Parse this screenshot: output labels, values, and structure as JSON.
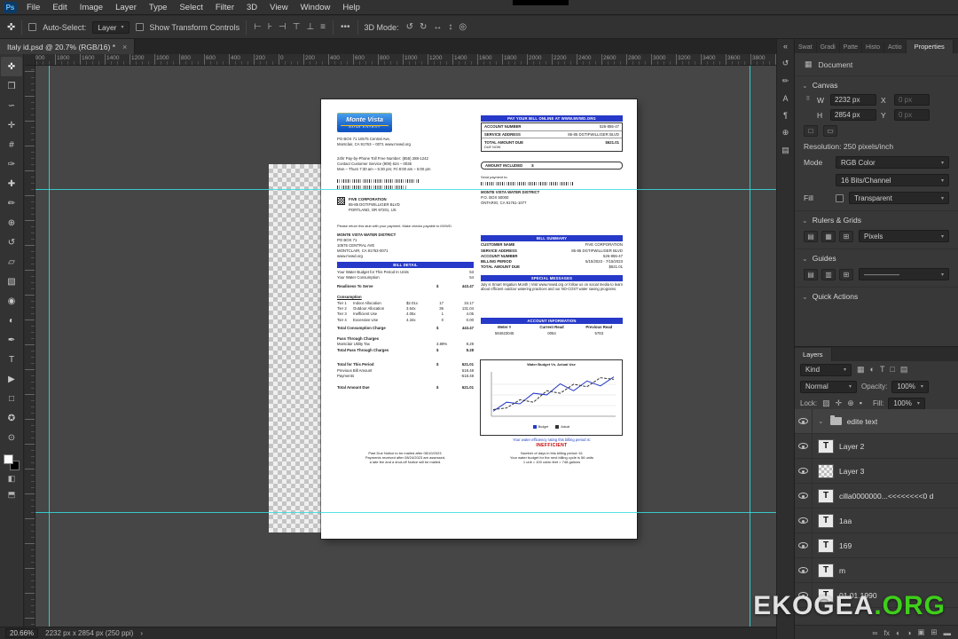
{
  "icons": {
    "ps_logo": "Ps",
    "close": "×",
    "caret_down": "▾",
    "chevron_down": "⌄",
    "chevron_right": "›",
    "ellipsis": "•••",
    "chain_link": "∞",
    "collapse_double": "«",
    "move_tool_glyph": "✜",
    "document_icon": "▦"
  },
  "menu": {
    "items": [
      "File",
      "Edit",
      "Image",
      "Layer",
      "Type",
      "Select",
      "Filter",
      "3D",
      "View",
      "Window",
      "Help"
    ]
  },
  "options": {
    "auto_select_label": "Auto-Select:",
    "auto_select_value": "Layer",
    "transform_label": "Show Transform Controls",
    "mode3d_label": "3D Mode:",
    "align_icons": [
      [
        "align-left",
        "⊢"
      ],
      [
        "align-center-h",
        "⊦"
      ],
      [
        "align-right",
        "⊣"
      ],
      [
        "align-top",
        "⊤"
      ],
      [
        "align-center-v",
        "⊥"
      ],
      [
        "align-bottom",
        "≡"
      ]
    ],
    "mode3d_icons": [
      [
        "3d-rotate",
        "↺"
      ],
      [
        "3d-roll",
        "↻"
      ],
      [
        "3d-pan",
        "↔"
      ],
      [
        "3d-slide",
        "↕"
      ],
      [
        "3d-scale",
        "◎"
      ]
    ]
  },
  "doc_tab": {
    "title": "Italy id.psd @ 20.7% (RGB/16) *"
  },
  "toolbar": {
    "tools": [
      [
        "move-tool",
        "✜"
      ],
      [
        "marquee-tool",
        "❒"
      ],
      [
        "lasso-tool",
        "∽"
      ],
      [
        "quick-selection-tool",
        "✛"
      ],
      [
        "crop-tool",
        "#"
      ],
      [
        "eyedropper-tool",
        "✑"
      ],
      [
        "healing-brush-tool",
        "✚"
      ],
      [
        "brush-tool",
        "✏"
      ],
      [
        "clone-stamp-tool",
        "⊕"
      ],
      [
        "history-brush-tool",
        "↺"
      ],
      [
        "eraser-tool",
        "▱"
      ],
      [
        "gradient-tool",
        "▧"
      ],
      [
        "blur-tool",
        "◉"
      ],
      [
        "dodge-tool",
        "◐"
      ],
      [
        "pen-tool",
        "✒"
      ],
      [
        "type-tool",
        "T"
      ],
      [
        "path-selection-tool",
        "▶"
      ],
      [
        "shape-tool",
        "□"
      ],
      [
        "hand-tool",
        "✪"
      ],
      [
        "zoom-tool",
        "⊙"
      ]
    ],
    "extras": [
      [
        "quick-mask-icon",
        "◧"
      ],
      [
        "screen-mode-icon",
        "⬒"
      ]
    ]
  },
  "ruler": {
    "labels": [
      "2000",
      "1800",
      "1600",
      "1400",
      "1200",
      "1000",
      "800",
      "600",
      "400",
      "200",
      "0",
      "200",
      "400",
      "600",
      "800",
      "1000",
      "1200",
      "1400",
      "1600",
      "1800",
      "2000",
      "2200",
      "2400",
      "2600",
      "2800",
      "3000",
      "3200",
      "3400",
      "3600",
      "3800"
    ]
  },
  "right_strip": {
    "icons": [
      [
        "expand-panels",
        "«"
      ],
      [
        "history-panel",
        "↺"
      ],
      [
        "brush-settings-panel",
        "✏"
      ],
      [
        "character-panel",
        "A"
      ],
      [
        "paragraph-panel",
        "¶"
      ],
      [
        "clone-source-panel",
        "⊕"
      ],
      [
        "libraries-panel",
        "▤"
      ]
    ]
  },
  "panels": {
    "tab_strip": [
      "Swat",
      "Gradi",
      "Patte",
      "Histo",
      "Actio"
    ],
    "properties_tab": "Properties",
    "properties": {
      "doc_row": "Document",
      "canvas_section": "Canvas",
      "w_label": "W",
      "w_value": "2232 px",
      "x_label": "X",
      "x_value": "0 px",
      "h_label": "H",
      "h_value": "2854 px",
      "y_label": "Y",
      "y_value": "0 px",
      "orient_icons": [
        [
          "orient-portrait",
          "□"
        ],
        [
          "orient-landscape",
          "▭"
        ]
      ],
      "resolution": "Resolution: 250 pixels/inch",
      "mode_label": "Mode",
      "mode_value": "RGB Color",
      "depth_value": "16 Bits/Channel",
      "fill_label": "Fill",
      "fill_value": "Transparent",
      "rulers_section": "Rulers & Grids",
      "rulers_icons": [
        [
          "ruler-icon",
          "▤"
        ],
        [
          "grid-icon",
          "▦"
        ],
        [
          "snap-icon",
          "⊞"
        ]
      ],
      "units_value": "Pixels",
      "guides_section": "Guides",
      "guides_icons": [
        [
          "new-guide-icon",
          "▤"
        ],
        [
          "guide-layout-icon",
          "▥"
        ],
        [
          "clear-guides-icon",
          "⊞"
        ]
      ],
      "guide_style": "—————",
      "quick_section": "Quick Actions"
    },
    "layers": {
      "tab": "Layers",
      "filter_label": "Kind",
      "filter_icons": [
        [
          "filter-pixel",
          "▦"
        ],
        [
          "filter-adjustment",
          "◐"
        ],
        [
          "filter-type",
          "T"
        ],
        [
          "filter-shape",
          "□"
        ],
        [
          "filter-smart",
          "▤"
        ]
      ],
      "blend_mode": "Normal",
      "opacity_label": "Opacity:",
      "opacity_value": "100%",
      "lock_label": "Lock:",
      "lock_icons": [
        [
          "lock-transparent",
          "▨"
        ],
        [
          "lock-paint",
          "✛"
        ],
        [
          "lock-position",
          "⊕"
        ],
        [
          "lock-all",
          "▪"
        ]
      ],
      "fill_label": "Fill:",
      "fill_value": "100%",
      "items": [
        {
          "name": "edite text",
          "kind": "group",
          "selected": true
        },
        {
          "name": "Layer 2",
          "kind": "text"
        },
        {
          "name": "Layer 3",
          "kind": "pixel"
        },
        {
          "name": "cilla0000000...<<<<<<<<0 d",
          "kind": "text"
        },
        {
          "name": "1aa",
          "kind": "text"
        },
        {
          "name": "169",
          "kind": "text"
        },
        {
          "name": "m",
          "kind": "text"
        },
        {
          "name": "01.01.1990",
          "kind": "text"
        }
      ],
      "bottom_icons": [
        [
          "link-layers",
          "∞"
        ],
        [
          "layer-style",
          "fx"
        ],
        [
          "add-mask",
          "◐"
        ],
        [
          "new-adjustment",
          "◑"
        ],
        [
          "new-group",
          "▣"
        ],
        [
          "new-layer",
          "⊞"
        ],
        [
          "delete-layer",
          "▬"
        ]
      ]
    }
  },
  "status": {
    "zoom": "20.66%",
    "info": "2232 px x 2854 px (250 ppi)"
  },
  "watermark": {
    "name": "EKOGEA",
    "tld": ".ORG"
  },
  "bill": {
    "logo": {
      "name": "Monte Vista",
      "subtitle": "WATER DISTRICT"
    },
    "address1": "PO BOX 71 10575 Central Ave,",
    "address2": "Montclair, CA 91763 – 0071 www.mvwd.org",
    "phone1": "24hr Pay-by-Phone Toll Free Number: (855) 288-1242",
    "phone2": "Contact Customer Service (909) 624 – 0035",
    "hours": "Mon – Thurs 7:30 am – 5:30 pm; Fri 8:00 am – 5:00 pm",
    "recipient": [
      "FIVE CORPORATION",
      "85-85 DGTIFWILLIGER BLVD",
      "PORTLAND, OR 97201, US"
    ],
    "stub_note": "Please return this stub with your payment. Make checks payable to MVWD.",
    "district": [
      "MONTE VISTA WATER DISTRICT",
      "PO BOX 71",
      "10575 CENTRAL AVE",
      "MONTCLAIR, CA 91763-0071",
      "www.mvwd.org"
    ],
    "detail": {
      "header": "BILL DETAIL",
      "budget_label": "Your Water Budget for This Period In Units",
      "budget_value": "53",
      "consumption_label": "Your Water Consumption",
      "consumption_value": "54",
      "readiness_label": "Readiness To Serve",
      "readiness_currency": "$",
      "readiness_value": "443.47",
      "consumption_header": "Consumption",
      "tiers": [
        [
          "Tier 1",
          "Indoor Allocation",
          "$2.01x",
          "17",
          "34.17"
        ],
        [
          "Tier 2",
          "Outdoor Allocation",
          "3.64x",
          "36",
          "131.04"
        ],
        [
          "Tier 3",
          "Inefficient Use",
          "4.05x",
          "1",
          "4.05"
        ],
        [
          "Tier 4",
          "Excessive Use",
          "4.34x",
          "0",
          "0.00"
        ]
      ],
      "total_consumption_label": "Total Consumption Charge",
      "total_consumption_currency": "$",
      "total_consumption_value": "443.47",
      "pass_header": "Pass Through Charges",
      "pass_label": "Montclair Utility Tax",
      "pass_rate": "3.89%",
      "pass_value": "8.29",
      "total_pass_label": "Total Pass Through Charges",
      "total_pass_currency": "$",
      "total_pass_value": "8.28",
      "period_label": "Total for This Period",
      "period_currency": "$",
      "period_value": "621.01",
      "previous_label": "Previous Bill Amount",
      "previous_value": "518.48",
      "payments_label": "Payments",
      "payments_value": "-518.48",
      "due_label": "Total Amount Due",
      "due_currency": "$",
      "due_value": "621.01"
    },
    "past_due": [
      "Past Due Notice to be mailed after 08/10/2023.",
      "Payments received after 08/24/2023 are assessed,",
      "a late fee and a shut-off Notice will be mailed."
    ],
    "pay_online": "PAY YOUR BILL ONLINE AT WWW.MVWD.ORG",
    "account_box": {
      "account_label": "ACCOUNT NUMBER",
      "account_value": "526-855-47",
      "service_label": "SERVICE ADDRESS",
      "service_value": "85-85 DGTIFWILLIGER BLVD",
      "due_label": "TOTAL AMOUNT DUE",
      "due_sub": "DUE NOW",
      "due_value": "$621.01"
    },
    "amount_included": "AMOUNT INCLUDED",
    "amount_symbol": "$",
    "send_payment": "Send payment to:",
    "payee": [
      "MONTE VISTA WATER DISTRICT",
      "P.O. BOX 50000",
      "ONTARIO, CA 91761-1077"
    ],
    "summary": {
      "header": "BILL SUMMARY",
      "rows": [
        [
          "CUSTOMER NAME",
          "FIVE CORPORATION"
        ],
        [
          "SERVICE ADDRESS",
          "85-85 DGTIFWILLIGER BLVD"
        ],
        [
          "ACCOUNT NUMBER",
          "526-855-47"
        ],
        [
          "BILLING PERIOD",
          "5/15/2023 - 7/15/2023"
        ],
        [
          "TOTAL AMOUNT DUE",
          "$621.01"
        ]
      ]
    },
    "messages": {
      "header": "SPECIAL MESSAGES",
      "body": "July is Smart Irrigation Month | Visit www.mvwd.org or follow us on social media to learn about efficient outdoor watering practices and our NO-COST water saving programs."
    },
    "account_info": {
      "header": "ACCOUNT INFORMATION",
      "columns": [
        "Meter #",
        "Current Read",
        "Previous Read"
      ],
      "values": [
        "584623045",
        "0054",
        "5783"
      ]
    },
    "chart": {
      "title": "Water Budget Vs. Actual Use",
      "legend": [
        {
          "label": "Budget",
          "color": "#2639c8"
        },
        {
          "label": "Actual",
          "color": "#333333"
        }
      ],
      "budget": [
        8,
        30,
        26,
        52,
        48,
        75,
        58,
        82,
        70,
        92
      ],
      "actual": [
        12,
        16,
        36,
        30,
        58,
        52,
        74,
        68,
        90,
        86
      ]
    },
    "efficiency_label": "Your water efficiency rating this billing period is:",
    "efficiency_value": "INEFFICIENT",
    "footer": [
      "Number of days in this billing period: 61",
      "Your water budget for the next billing cycle is 56 units",
      "1 unit = 100 cubic feet = 748 gallons"
    ]
  }
}
